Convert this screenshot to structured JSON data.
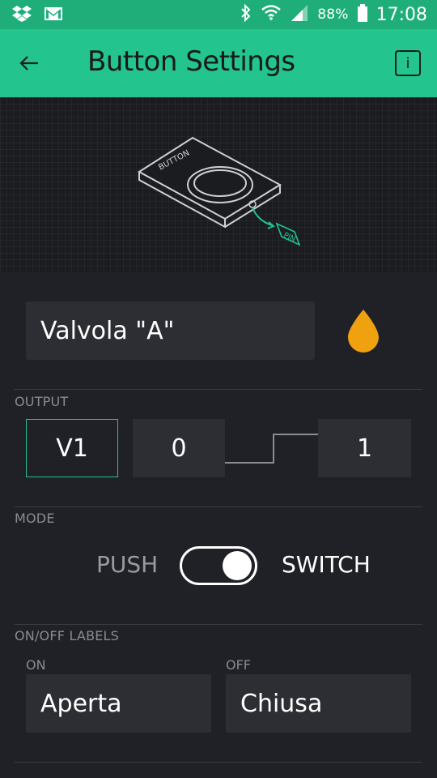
{
  "status_bar": {
    "battery_percent": "88%",
    "time": "17:08",
    "icons": [
      "dropbox-icon",
      "gmail-icon",
      "bluetooth-icon",
      "wifi-icon",
      "signal-icon",
      "battery-icon"
    ]
  },
  "app_bar": {
    "title": "Button Settings",
    "info_label": "i",
    "color": "#23c48e"
  },
  "illustration": {
    "device_label": "BUTTON",
    "pin_label": "PIN"
  },
  "widget": {
    "name": "Valvola \"A\"",
    "color": "#f0a10f"
  },
  "output": {
    "section_label": "OUTPUT",
    "pin": "V1",
    "low_value": "0",
    "high_value": "1"
  },
  "mode": {
    "section_label": "MODE",
    "push_label": "PUSH",
    "switch_label": "SWITCH",
    "selected": "SWITCH"
  },
  "labels": {
    "section_label": "ON/OFF LABELS",
    "on_label": "ON",
    "off_label": "OFF",
    "on_value": "Aperta",
    "off_value": "Chiusa"
  }
}
